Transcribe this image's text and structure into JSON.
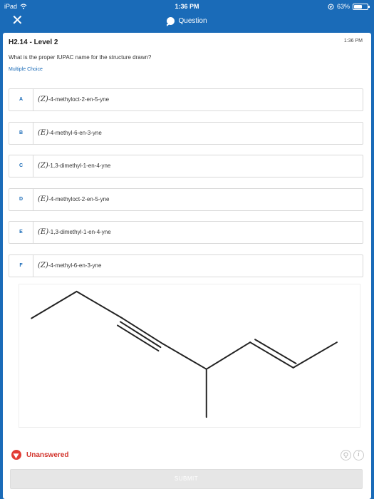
{
  "statusbar": {
    "device": "iPad",
    "time": "1:36 PM",
    "battery": "63%",
    "battery_level": 0.63
  },
  "navbar": {
    "close_glyph": "✕",
    "title": "Question"
  },
  "question": {
    "title": "H2.14 - Level 2",
    "time": "1:36 PM",
    "text": "What is the proper IUPAC name for the structure drawn?",
    "type": "Multiple Choice"
  },
  "choices": [
    {
      "letter": "A",
      "desc": "(Z)",
      "name": "-4-methyloct-2-en-5-yne"
    },
    {
      "letter": "B",
      "desc": "(E)",
      "name": "-4-methyl-6-en-3-yne"
    },
    {
      "letter": "C",
      "desc": "(Z)",
      "name": "-1,3-dimethyl-1-en-4-yne"
    },
    {
      "letter": "D",
      "desc": "(E)",
      "name": "-4-methyloct-2-en-5-yne"
    },
    {
      "letter": "E",
      "desc": "(E)",
      "name": "-1,3-dimethyl-1-en-4-yne"
    },
    {
      "letter": "F",
      "desc": "(Z)",
      "name": "-4-methyl-6-en-3-yne"
    }
  ],
  "status": {
    "label": "Unanswered",
    "color": "#e23c34"
  },
  "tools": {
    "hint_icon": "lightbulb-icon",
    "info_glyph": "i"
  },
  "submit_label": "SUBMIT",
  "colors": {
    "brand": "#1a6bb8",
    "submit_bg": "#e6e6e6"
  }
}
